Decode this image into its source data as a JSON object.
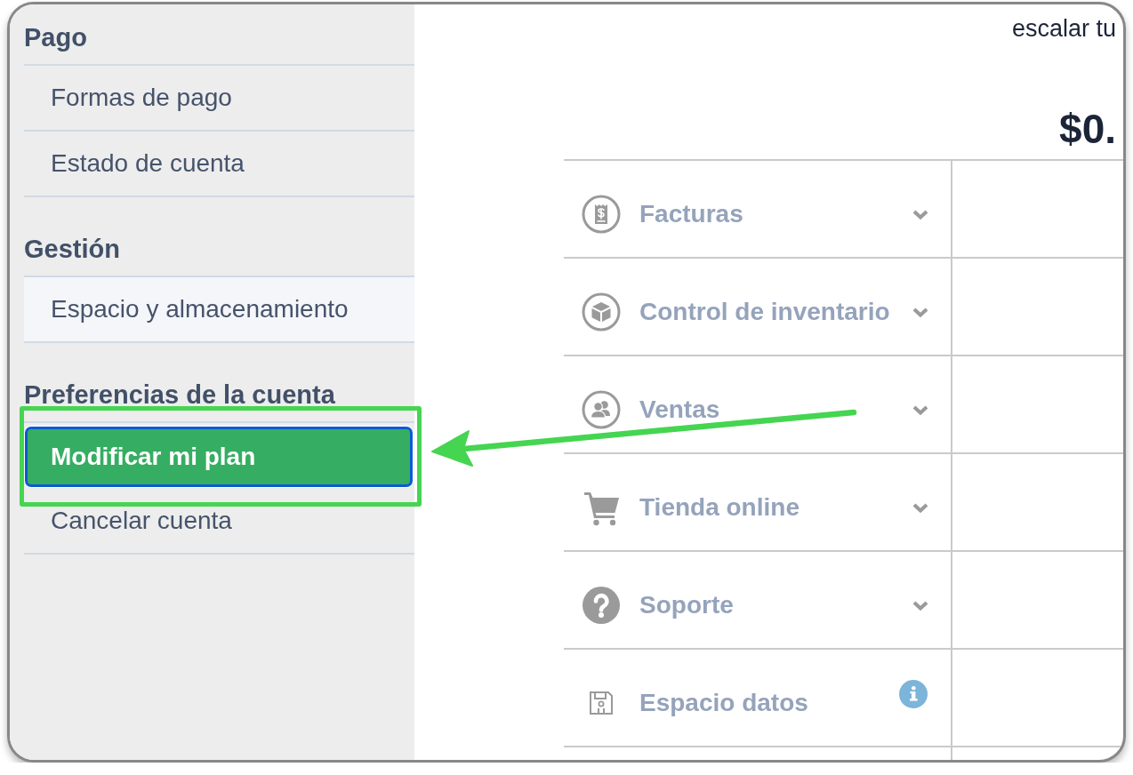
{
  "sidebar": {
    "sections": [
      {
        "title": "Pago",
        "items": [
          {
            "label": "Formas de pago",
            "selected": false,
            "highlighted": false
          },
          {
            "label": "Estado de cuenta",
            "selected": false,
            "highlighted": false
          }
        ]
      },
      {
        "title": "Gestión",
        "items": [
          {
            "label": "Espacio y almacenamiento",
            "selected": false,
            "highlighted": true
          }
        ]
      },
      {
        "title": "Preferencias de la cuenta",
        "items": [
          {
            "label": "Modificar mi plan",
            "selected": true,
            "highlighted": false
          },
          {
            "label": "Cancelar cuenta",
            "selected": false,
            "highlighted": false
          }
        ]
      }
    ]
  },
  "plan": {
    "description": "escalar tu",
    "price": "$0."
  },
  "features": [
    {
      "label": "Facturas",
      "kind": "dropdown"
    },
    {
      "label": "Control de inventario",
      "kind": "dropdown"
    },
    {
      "label": "Ventas",
      "kind": "dropdown"
    },
    {
      "label": "Tienda online",
      "kind": "dropdown"
    },
    {
      "label": "Soporte",
      "kind": "dropdown"
    },
    {
      "label": "Espacio datos",
      "kind": "info"
    }
  ],
  "annotation": {
    "highlight_box": true,
    "arrow": true
  }
}
